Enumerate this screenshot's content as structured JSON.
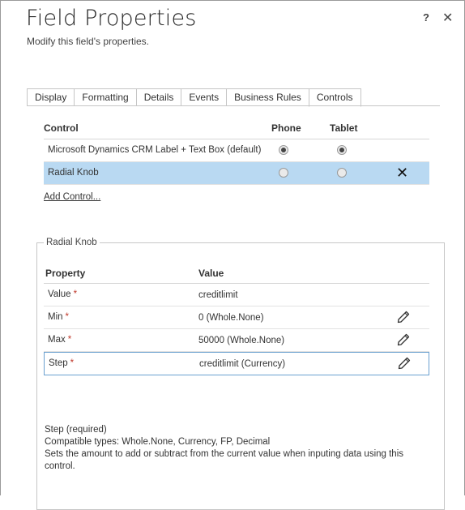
{
  "dialog": {
    "title": "Field Properties",
    "subtitle": "Modify this field's properties.",
    "help_label": "?",
    "close_label": "✕"
  },
  "tabs": [
    {
      "label": "Display",
      "active": false
    },
    {
      "label": "Formatting",
      "active": false
    },
    {
      "label": "Details",
      "active": false
    },
    {
      "label": "Events",
      "active": false
    },
    {
      "label": "Business Rules",
      "active": false
    },
    {
      "label": "Controls",
      "active": true
    }
  ],
  "controls_table": {
    "headers": {
      "control": "Control",
      "phone": "Phone",
      "tablet": "Tablet"
    },
    "rows": [
      {
        "name": "Microsoft Dynamics CRM Label + Text Box (default)",
        "phone": true,
        "tablet": true,
        "selected": false
      },
      {
        "name": "Radial Knob",
        "phone": false,
        "tablet": false,
        "selected": true,
        "remove_label": "✕"
      }
    ],
    "add_control_label": "Add Control..."
  },
  "section": {
    "legend": "Radial Knob",
    "headers": {
      "property": "Property",
      "value": "Value"
    },
    "properties": [
      {
        "name": "Value",
        "required_mark": "*",
        "value": "creditlimit",
        "editable": false
      },
      {
        "name": "Min",
        "required_mark": "*",
        "value": "0 (Whole.None)",
        "editable": true
      },
      {
        "name": "Max",
        "required_mark": "*",
        "value": "50000 (Whole.None)",
        "editable": true
      },
      {
        "name": "Step",
        "required_mark": "*",
        "value": "creditlimit (Currency)",
        "editable": true
      }
    ],
    "description": {
      "line1": "Step (required)",
      "line2": "Compatible types: Whole.None, Currency, FP, Decimal",
      "line3": "Sets the amount to add or subtract from the current value when inputing data using this",
      "line4": "control."
    }
  },
  "colors": {
    "selected_row": "#b9d9f2",
    "required": "#c0392b",
    "focus_border": "#6aa0cf"
  }
}
